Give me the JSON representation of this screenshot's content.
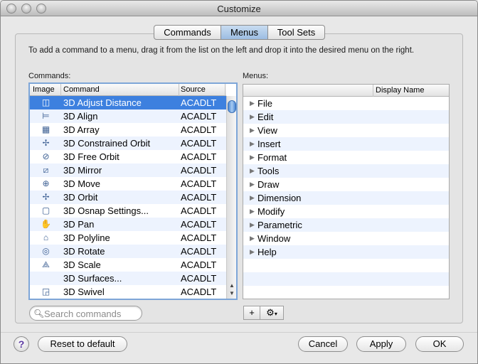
{
  "window": {
    "title": "Customize"
  },
  "tabs": [
    {
      "label": "Commands"
    },
    {
      "label": "Menus"
    },
    {
      "label": "Tool Sets"
    }
  ],
  "instructions": "To add a command to a menu, drag it from the list on the left and drop it into the desired menu on the right.",
  "commands": {
    "label": "Commands:",
    "headers": {
      "image": "Image",
      "command": "Command",
      "source": "Source"
    },
    "rows": [
      {
        "icon": "adjust-distance-icon",
        "glyph": "◫",
        "name": "3D Adjust Distance",
        "source": "ACADLT"
      },
      {
        "icon": "align-icon",
        "glyph": "⊨",
        "name": "3D Align",
        "source": "ACADLT"
      },
      {
        "icon": "array-icon",
        "glyph": "▦",
        "name": "3D Array",
        "source": "ACADLT"
      },
      {
        "icon": "constrained-orbit-icon",
        "glyph": "✢",
        "name": "3D Constrained Orbit",
        "source": "ACADLT"
      },
      {
        "icon": "free-orbit-icon",
        "glyph": "⊘",
        "name": "3D Free Orbit",
        "source": "ACADLT"
      },
      {
        "icon": "mirror-icon",
        "glyph": "⧄",
        "name": "3D Mirror",
        "source": "ACADLT"
      },
      {
        "icon": "move-icon",
        "glyph": "⊕",
        "name": "3D Move",
        "source": "ACADLT"
      },
      {
        "icon": "orbit-icon",
        "glyph": "✢",
        "name": "3D Orbit",
        "source": "ACADLT"
      },
      {
        "icon": "osnap-settings-icon",
        "glyph": "▢",
        "name": "3D Osnap Settings...",
        "source": "ACADLT"
      },
      {
        "icon": "pan-icon",
        "glyph": "✋",
        "name": "3D Pan",
        "source": "ACADLT"
      },
      {
        "icon": "polyline-icon",
        "glyph": "⌂",
        "name": "3D Polyline",
        "source": "ACADLT"
      },
      {
        "icon": "rotate-icon",
        "glyph": "◎",
        "name": "3D Rotate",
        "source": "ACADLT"
      },
      {
        "icon": "scale-icon",
        "glyph": "⟁",
        "name": "3D Scale",
        "source": "ACADLT"
      },
      {
        "icon": "",
        "glyph": "",
        "name": "3D Surfaces...",
        "source": "ACADLT"
      },
      {
        "icon": "swivel-icon",
        "glyph": "◲",
        "name": "3D Swivel",
        "source": "ACADLT"
      }
    ]
  },
  "menus": {
    "label": "Menus:",
    "header": "Display Name",
    "items": [
      "File",
      "Edit",
      "View",
      "Insert",
      "Format",
      "Tools",
      "Draw",
      "Dimension",
      "Modify",
      "Parametric",
      "Window",
      "Help"
    ]
  },
  "search": {
    "placeholder": "Search commands",
    "value": ""
  },
  "menu_buttons": {
    "add": "+",
    "gear": "⚙"
  },
  "footer": {
    "help": "?",
    "reset": "Reset to default",
    "cancel": "Cancel",
    "apply": "Apply",
    "ok": "OK"
  }
}
